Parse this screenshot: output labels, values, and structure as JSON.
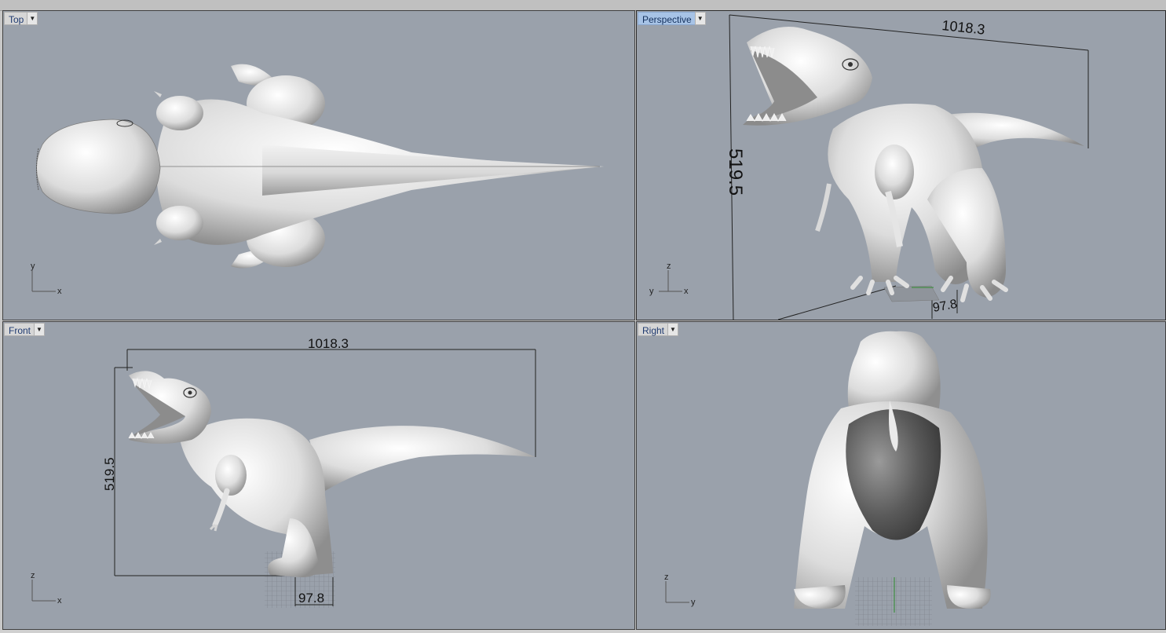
{
  "viewports": [
    {
      "id": "top",
      "label": "Top",
      "active": false,
      "axes": [
        "y",
        "x"
      ]
    },
    {
      "id": "perspective",
      "label": "Perspective",
      "active": true,
      "axes": [
        "z",
        "y",
        "x"
      ],
      "dimensions": {
        "length": "1018.3",
        "height": "519.5",
        "width": "97.8"
      }
    },
    {
      "id": "front",
      "label": "Front",
      "active": false,
      "axes": [
        "z",
        "x"
      ],
      "dimensions": {
        "length": "1018.3",
        "height": "519.5",
        "width": "97.8"
      }
    },
    {
      "id": "right",
      "label": "Right",
      "active": false,
      "axes": [
        "z",
        "y"
      ]
    }
  ],
  "colors": {
    "viewport_bg": "#9aa1ab",
    "active_tab": "#a7c3e6",
    "model": "#e8e8e8"
  },
  "icons": {
    "viewport_menu": "caret-down-icon"
  }
}
